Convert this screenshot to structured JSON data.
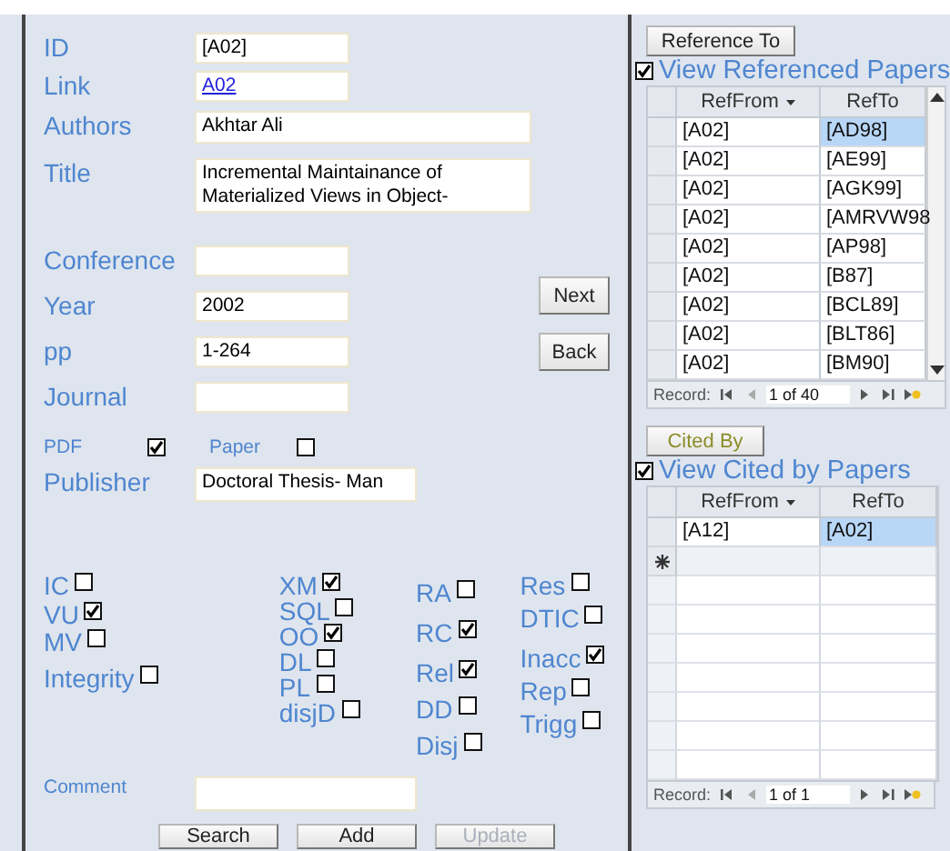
{
  "form": {
    "fields": [
      {
        "label": "ID",
        "value": "[A02]",
        "kind": "short"
      },
      {
        "label": "Link",
        "value": "A02",
        "kind": "link"
      },
      {
        "label": "Authors",
        "value": "Akhtar Ali",
        "kind": "long"
      },
      {
        "label": "Title",
        "value": "Incremental Maintainance of Materialized Views in Object-",
        "kind": "multiline"
      },
      {
        "label": "Conference",
        "kind": "short"
      },
      {
        "label": "Year",
        "value": "2002",
        "kind": "short"
      },
      {
        "label": "pp",
        "value": "1-264",
        "kind": "short"
      },
      {
        "label": "Journal",
        "kind": "short"
      }
    ],
    "nav_buttons": [
      "Next",
      "Back"
    ],
    "pdf": {
      "label": "PDF",
      "checked": true
    },
    "paper": {
      "label": "Paper",
      "checked": false
    },
    "publisher": {
      "label": "Publisher",
      "value": "Doctoral Thesis- Man"
    },
    "flag_columns": [
      [
        {
          "label": "IC",
          "checked": false
        },
        {
          "label": "VU",
          "checked": true
        },
        {
          "label": "MV",
          "checked": false
        },
        {
          "label": "Integrity",
          "checked": false
        }
      ],
      [
        {
          "label": "XM",
          "checked": true
        },
        {
          "label": "SQL",
          "checked": false
        },
        {
          "label": "OO",
          "checked": true
        },
        {
          "label": "DL",
          "checked": false
        },
        {
          "label": "PL",
          "checked": false
        },
        {
          "label": "disjD",
          "checked": false
        }
      ],
      [
        {
          "label": "RA",
          "checked": false
        },
        {
          "label": "RC",
          "checked": true
        },
        {
          "label": "Rel",
          "checked": true
        },
        {
          "label": "DD",
          "checked": false
        },
        {
          "label": "Disj",
          "checked": false
        }
      ],
      [
        {
          "label": "Res",
          "checked": false
        },
        {
          "label": "DTIC",
          "checked": false
        },
        {
          "label": "Inacc",
          "checked": true
        },
        {
          "label": "Rep",
          "checked": false
        },
        {
          "label": "Trigg",
          "checked": false
        }
      ]
    ],
    "comment": {
      "label": "Comment"
    },
    "action_buttons": [
      {
        "label": "Search",
        "disabled": false
      },
      {
        "label": "Add",
        "disabled": false
      },
      {
        "label": "Update",
        "disabled": true
      }
    ]
  },
  "referenced": {
    "button": "Reference To",
    "checked": true,
    "title": "View Referenced Papers",
    "columns": [
      "RefFrom",
      "RefTo"
    ],
    "new_row": false,
    "rows": [
      [
        "[A02]",
        "[AD98]"
      ],
      [
        "[A02]",
        "[AE99]"
      ],
      [
        "[A02]",
        "[AGK99]"
      ],
      [
        "[A02]",
        "[AMRVW98"
      ],
      [
        "[A02]",
        "[AP98]"
      ],
      [
        "[A02]",
        "[B87]"
      ],
      [
        "[A02]",
        "[BCL89]"
      ],
      [
        "[A02]",
        "[BLT86]"
      ],
      [
        "[A02]",
        "[BM90]"
      ]
    ],
    "record_label": "Record:",
    "position": "1 of 40"
  },
  "cited": {
    "button": "Cited By",
    "checked": true,
    "title": "View Cited by Papers",
    "columns": [
      "RefFrom",
      "RefTo"
    ],
    "new_row": true,
    "rows": [
      [
        "[A12]",
        "[A02]"
      ]
    ],
    "record_label": "Record:",
    "position": "1 of 1"
  }
}
